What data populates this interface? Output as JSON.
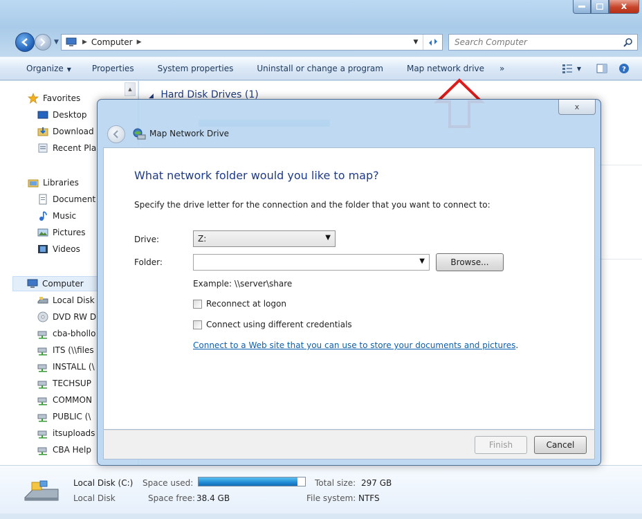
{
  "window": {
    "close_label": "x"
  },
  "address": {
    "crumb": "Computer",
    "search_placeholder": "Search Computer"
  },
  "commandbar": {
    "organize": "Organize",
    "properties": "Properties",
    "system_properties": "System properties",
    "uninstall": "Uninstall or change a program",
    "map_drive": "Map network drive",
    "more": "»"
  },
  "navpane": {
    "favorites": "Favorites",
    "desktop": "Desktop",
    "downloads": "Download",
    "recent": "Recent Pla",
    "libraries": "Libraries",
    "documents": "Document",
    "music": "Music",
    "pictures": "Pictures",
    "videos": "Videos",
    "computer": "Computer",
    "local_disk": "Local Disk",
    "dvd": "DVD RW D",
    "cba": "cba-bhollo",
    "its": "ITS (\\\\files",
    "install": "INSTALL (\\",
    "techsup": "TECHSUP",
    "common": "COMMON",
    "public": "PUBLIC (\\",
    "itsuploads": "itsuploads",
    "cbahelp": "CBA Help"
  },
  "content": {
    "group_header": "Hard Disk Drives (1)"
  },
  "details": {
    "drive_name": "Local Disk (C:)",
    "drive_type": "Local Disk",
    "space_used_label": "Space used:",
    "space_used_fraction": 0.93,
    "space_free_label": "Space free:",
    "space_free_value": "38.4 GB",
    "total_size_label": "Total size:",
    "total_size_value": "297 GB",
    "file_system_label": "File system:",
    "file_system_value": "NTFS"
  },
  "dialog": {
    "title": "Map Network Drive",
    "close_label": "x",
    "heading": "What network folder would you like to map?",
    "instructions": "Specify the drive letter for the connection and the folder that you want to connect to:",
    "drive_label": "Drive:",
    "drive_value": "Z:",
    "folder_label": "Folder:",
    "folder_value": "",
    "browse_label": "Browse...",
    "example": "Example: \\\\server\\share",
    "reconnect_label": "Reconnect at logon",
    "credentials_label": "Connect using different credentials",
    "link_text": "Connect to a Web site that you can use to store your documents and pictures",
    "link_suffix": ".",
    "finish_label": "Finish",
    "cancel_label": "Cancel"
  },
  "colors": {
    "accent_red": "#e01b1b",
    "heading_blue": "#1e3a8a",
    "link_blue": "#0b5fb0"
  }
}
